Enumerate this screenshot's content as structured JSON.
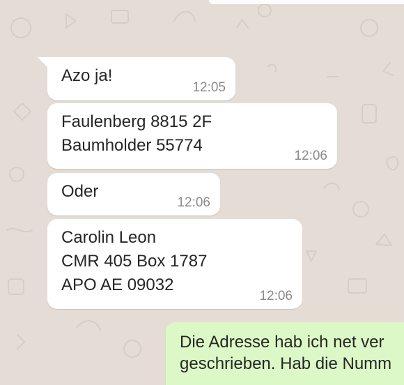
{
  "messages": [
    {
      "direction": "incoming",
      "lines": [
        "Azo ja!"
      ],
      "time": "12:05"
    },
    {
      "direction": "incoming",
      "lines": [
        "Faulenberg 8815 2F",
        "Baumholder 55774"
      ],
      "time": "12:06"
    },
    {
      "direction": "incoming",
      "lines": [
        "Oder"
      ],
      "time": "12:06"
    },
    {
      "direction": "incoming",
      "lines": [
        "Carolin Leon",
        "CMR 405 Box 1787",
        "APO AE 09032"
      ],
      "time": "12:06"
    },
    {
      "direction": "outgoing",
      "lines": [
        "Die Adresse hab ich net ver",
        "geschrieben. Hab die Numm"
      ],
      "time": ""
    }
  ],
  "colors": {
    "chat_background": "#e5ddd5",
    "incoming_bubble": "#ffffff",
    "outgoing_bubble": "#dcf8c6",
    "timestamp": "#8a8a8a"
  }
}
